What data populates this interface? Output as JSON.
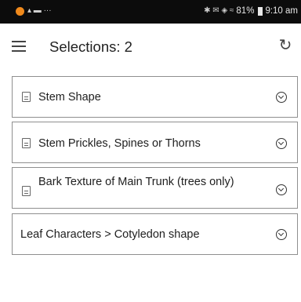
{
  "status_bar": {
    "notification_icons": "▴ ▬ ···",
    "signal_icons": "✱ ✉ ◈ ≈",
    "battery_percent": "81%",
    "time": "9:10 am"
  },
  "toolbar": {
    "title": "Selections: 2",
    "menu_icon": "hamburger-menu-icon",
    "refresh_icon": "refresh-icon"
  },
  "cards": [
    {
      "label": "Stem Shape",
      "has_doc_icon": true
    },
    {
      "label": "Stem Prickles, Spines or Thorns",
      "has_doc_icon": true
    },
    {
      "label": "Bark Texture of Main Trunk (trees only)",
      "has_doc_icon": true
    },
    {
      "label": "Leaf Characters > Cotyledon shape",
      "has_doc_icon": false
    }
  ],
  "colors": {
    "status_bar_bg": "#0c0c0c",
    "card_border": "#8f8f8f",
    "accent_dot": "#f08a1c"
  }
}
